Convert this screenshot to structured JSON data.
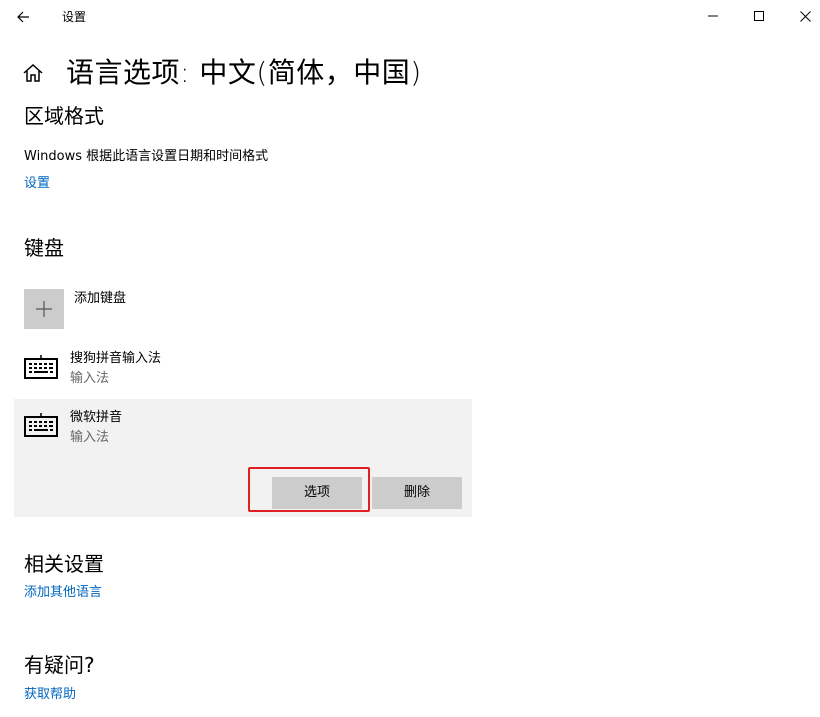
{
  "titlebar": {
    "title": "设置",
    "icons": {
      "back": "back-arrow-icon",
      "minimize": "minimize-icon",
      "maximize": "maximize-icon",
      "close": "close-icon"
    }
  },
  "page": {
    "title": "语言选项: 中文(简体，中国)",
    "home_icon": "home-icon"
  },
  "regional_format": {
    "heading": "区域格式",
    "description": "Windows 根据此语言设置日期和时间格式",
    "link": "设置"
  },
  "keyboards": {
    "heading": "键盘",
    "add_label": "添加键盘",
    "items": [
      {
        "name": "搜狗拼音输入法",
        "type": "输入法",
        "icon": "keyboard-icon"
      },
      {
        "name": "微软拼音",
        "type": "输入法",
        "icon": "keyboard-icon",
        "selected": true
      }
    ],
    "options_button": "选项",
    "remove_button": "删除"
  },
  "related": {
    "heading": "相关设置",
    "link": "添加其他语言"
  },
  "help": {
    "heading": "有疑问?",
    "link": "获取帮助"
  },
  "colors": {
    "link": "#0067c0",
    "button": "#cccccc",
    "selected_bg": "#f2f2f2",
    "highlight": "#e02020"
  }
}
